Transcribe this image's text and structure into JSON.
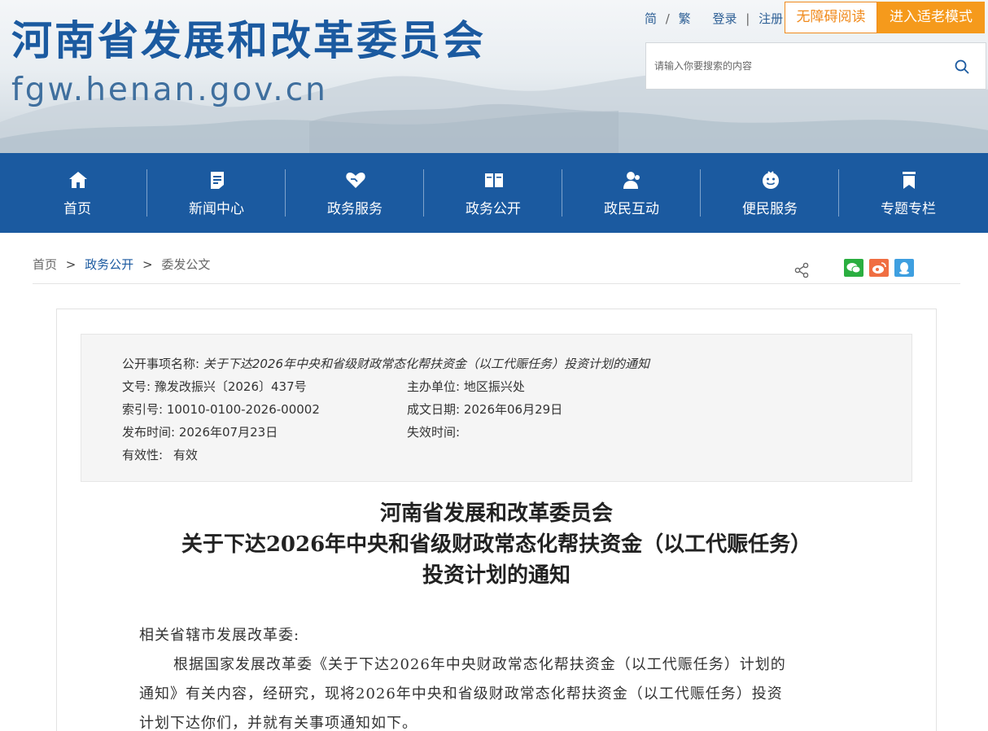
{
  "header": {
    "site_title": "河南省发展和改革委员会",
    "site_url": "fgw.henan.gov.cn",
    "links": {
      "simplified": "简",
      "slash": "/",
      "traditional": "繁",
      "login": "登录",
      "divider": "|",
      "register": "注册"
    },
    "accessible_reading": "无障碍阅读",
    "elder_mode": "进入适老模式",
    "search_placeholder": "请输入你要搜索的内容"
  },
  "nav": {
    "items": [
      {
        "label": "首页",
        "icon": "home-icon"
      },
      {
        "label": "新闻中心",
        "icon": "document-icon"
      },
      {
        "label": "政务服务",
        "icon": "heart-hand-icon"
      },
      {
        "label": "政务公开",
        "icon": "book-icon"
      },
      {
        "label": "政民互动",
        "icon": "users-icon"
      },
      {
        "label": "便民服务",
        "icon": "smile-icon"
      },
      {
        "label": "专题专栏",
        "icon": "bookmark-icon"
      }
    ]
  },
  "breadcrumb": {
    "home": "首页",
    "gt": ">",
    "section": "政务公开",
    "current": "委发公文"
  },
  "meta": {
    "item_name_label": "公开事项名称:",
    "item_name_value": "关于下达2026年中央和省级财政常态化帮扶资金（以工代赈任务）投资计划的通知",
    "doc_no_label": "文号:",
    "doc_no_value": "豫发改振兴〔2026〕437号",
    "host_label": "主办单位:",
    "host_value": "地区振兴处",
    "index_label": "索引号:",
    "index_value": "10010-0100-2026-00002",
    "created_label": "成文日期:",
    "created_value": "2026年06月29日",
    "published_label": "发布时间:",
    "published_value": "2026年07月23日",
    "expiry_label": "失效时间:",
    "expiry_value": "",
    "validity_label": "有效性:",
    "validity_value": "有效"
  },
  "document": {
    "title_line1": "河南省发展和改革委员会",
    "title_line2": "关于下达2026年中央和省级财政常态化帮扶资金（以工代赈任务）",
    "title_line3": "投资计划的通知",
    "salutation": "相关省辖市发展改革委:",
    "para1_line1": "根据国家发展改革委《关于下达2026年中央财政常态化帮扶资金（以工代赈任务）计划的",
    "para1_line2": "通知》有关内容，经研究，现将2026年中央和省级财政常态化帮扶资金（以工代赈任务）投资",
    "para1_line3": "计划下达你们，并就有关事项通知如下。"
  },
  "colors": {
    "primary_blue": "#1b5aa0",
    "orange": "#f59a1c",
    "wechat": "#2aae40",
    "weibo": "#f06e42",
    "qq": "#3e9fe0"
  }
}
